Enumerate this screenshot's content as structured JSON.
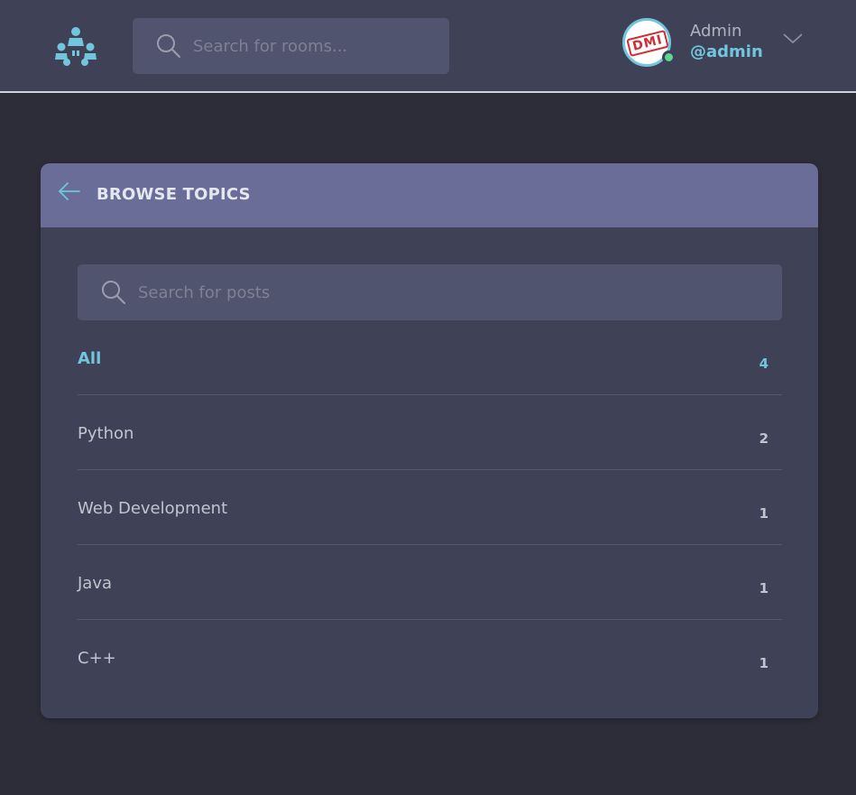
{
  "header": {
    "logo_icon": "community-logo-icon",
    "search": {
      "placeholder": "Search for rooms...",
      "value": ""
    },
    "user": {
      "avatar_text": "DMI",
      "name": "Admin",
      "handle": "@admin",
      "status_color": "#5dd693"
    }
  },
  "topics_card": {
    "title": "BROWSE TOPICS",
    "search": {
      "placeholder": "Search for posts",
      "value": ""
    },
    "items": [
      {
        "label": "All",
        "count": "4",
        "active": true
      },
      {
        "label": "Python",
        "count": "2",
        "active": false
      },
      {
        "label": "Web Development",
        "count": "1",
        "active": false
      },
      {
        "label": "Java",
        "count": "1",
        "active": false
      },
      {
        "label": "C++",
        "count": "1",
        "active": false
      }
    ]
  },
  "colors": {
    "background": "#2d2d39",
    "surface": "#3f4156",
    "card_header": "#696d97",
    "accent": "#71c6dd",
    "input": "#51546e"
  }
}
